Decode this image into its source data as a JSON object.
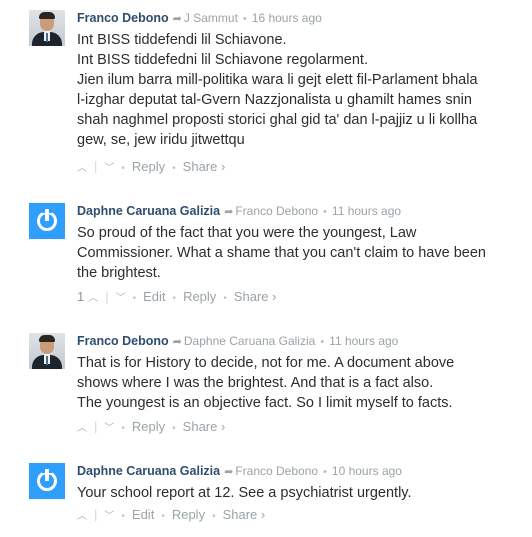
{
  "comments": [
    {
      "author": "Franco Debono",
      "parent": "J Sammut",
      "time": "16 hours ago",
      "avatar": "photo",
      "lines": [
        "Int BISS tiddefendi lil Schiavone.",
        "Int BISS tiddefedni lil Schiavone regolarment.",
        "Jien ilum barra mill-politika wara li gejt elett fil-Parlament bhala",
        "l-izghar deputat tal-Gvern Nazzjonalista u ghamilt hames snin",
        "shah naghmel proposti storici ghal gid ta' dan l-pajjiz u li kollha",
        "gew, se, jew iridu jitwettqu"
      ],
      "votes": "",
      "actions": {
        "reply": "Reply",
        "share": "Share ›"
      }
    },
    {
      "author": "Daphne Caruana Galizia",
      "parent": "Franco Debono",
      "time": "11 hours ago",
      "avatar": "disqus",
      "lines": [
        "So proud of the fact that you were the youngest, Law",
        "Commissioner. What a shame that you can't claim to have been",
        "the brightest."
      ],
      "votes": "1",
      "actions": {
        "edit": "Edit",
        "reply": "Reply",
        "share": "Share ›"
      }
    },
    {
      "author": "Franco Debono",
      "parent": "Daphne Caruana Galizia",
      "time": "11 hours ago",
      "avatar": "photo",
      "lines": [
        "That is for History to decide, not for me. A document above",
        "shows where I was the brightest. And that is a fact also.",
        "The youngest is an objective fact. So I limit myself to facts."
      ],
      "votes": "",
      "actions": {
        "reply": "Reply",
        "share": "Share ›"
      }
    },
    {
      "author": "Daphne Caruana Galizia",
      "parent": "Franco Debono",
      "time": "10 hours ago",
      "avatar": "disqus",
      "lines": [
        "Your school report at 12. See a psychiatrist urgently."
      ],
      "votes": "",
      "actions": {
        "edit": "Edit",
        "reply": "Reply",
        "share": "Share ›"
      }
    }
  ],
  "icons": {
    "upvote": "chevron-up-icon",
    "downvote": "chevron-down-icon",
    "reply_arrow": "reply-arrow-icon"
  },
  "colors": {
    "author": "#2f4d6d",
    "meta": "#9aa3a8",
    "disqus_blue": "#2e9fff"
  }
}
